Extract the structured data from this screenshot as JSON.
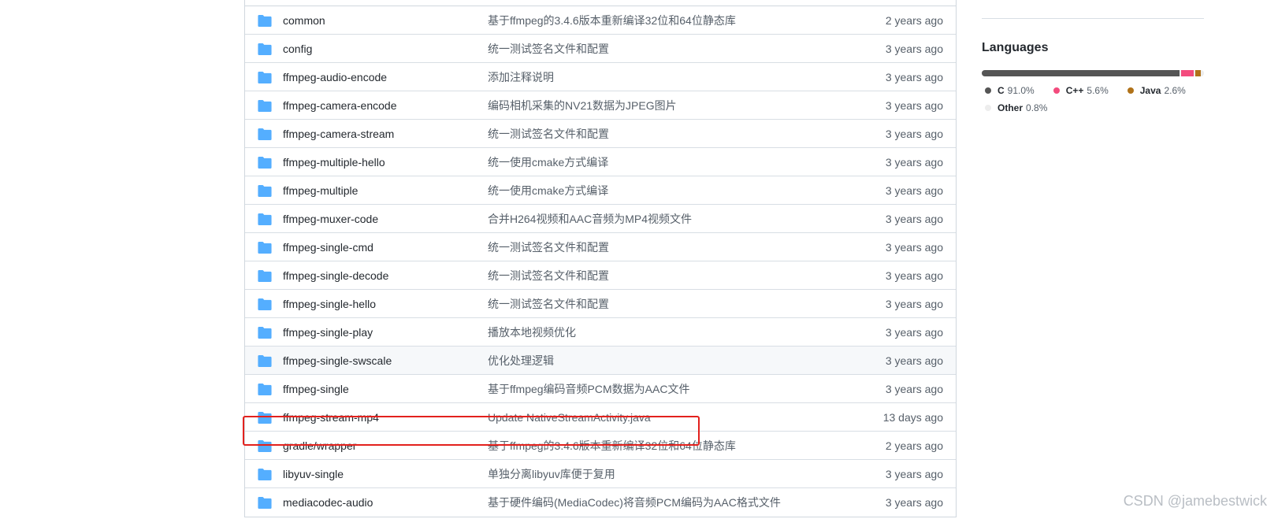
{
  "file_list": {
    "rows": [
      {
        "name": "common",
        "message": "基于ffmpeg的3.4.6版本重新编译32位和64位静态库",
        "age": "2 years ago"
      },
      {
        "name": "config",
        "message": "统一测试签名文件和配置",
        "age": "3 years ago"
      },
      {
        "name": "ffmpeg-audio-encode",
        "message": "添加注释说明",
        "age": "3 years ago"
      },
      {
        "name": "ffmpeg-camera-encode",
        "message": "编码相机采集的NV21数据为JPEG图片",
        "age": "3 years ago"
      },
      {
        "name": "ffmpeg-camera-stream",
        "message": "统一测试签名文件和配置",
        "age": "3 years ago"
      },
      {
        "name": "ffmpeg-multiple-hello",
        "message": "统一使用cmake方式编译",
        "age": "3 years ago"
      },
      {
        "name": "ffmpeg-multiple",
        "message": "统一使用cmake方式编译",
        "age": "3 years ago"
      },
      {
        "name": "ffmpeg-muxer-code",
        "message": "合并H264视频和AAC音频为MP4视频文件",
        "age": "3 years ago"
      },
      {
        "name": "ffmpeg-single-cmd",
        "message": "统一测试签名文件和配置",
        "age": "3 years ago"
      },
      {
        "name": "ffmpeg-single-decode",
        "message": "统一测试签名文件和配置",
        "age": "3 years ago"
      },
      {
        "name": "ffmpeg-single-hello",
        "message": "统一测试签名文件和配置",
        "age": "3 years ago"
      },
      {
        "name": "ffmpeg-single-play",
        "message": "播放本地视频优化",
        "age": "3 years ago"
      },
      {
        "name": "ffmpeg-single-swscale",
        "message": "优化处理逻辑",
        "age": "3 years ago"
      },
      {
        "name": "ffmpeg-single",
        "message": "基于ffmpeg编码音频PCM数据为AAC文件",
        "age": "3 years ago"
      },
      {
        "name": "ffmpeg-stream-mp4",
        "message": "Update NativeStreamActivity.java",
        "age": "13 days ago"
      },
      {
        "name": "gradle/wrapper",
        "message": "基于ffmpeg的3.4.6版本重新编译32位和64位静态库",
        "age": "2 years ago"
      },
      {
        "name": "libyuv-single",
        "message": "单独分离libyuv库便于复用",
        "age": "3 years ago"
      },
      {
        "name": "mediacodec-audio",
        "message": "基于硬件编码(MediaCodec)将音频PCM编码为AAC格式文件",
        "age": "3 years ago"
      }
    ],
    "hover_row_index": 12,
    "highlighted_row_index": 14,
    "icon": "folder-icon",
    "folder_color": "#54aeff",
    "highlight_color": "#e3211d"
  },
  "sidebar": {
    "languages_title": "Languages",
    "languages": [
      {
        "name": "C",
        "percent": "91.0%",
        "value": 91.0,
        "color": "#555555"
      },
      {
        "name": "C++",
        "percent": "5.6%",
        "value": 5.6,
        "color": "#f34b7d"
      },
      {
        "name": "Java",
        "percent": "2.6%",
        "value": 2.6,
        "color": "#b07219"
      },
      {
        "name": "Other",
        "percent": "0.8%",
        "value": 0.8,
        "color": "#ededed"
      }
    ]
  },
  "watermark": "CSDN @jamebestwick"
}
